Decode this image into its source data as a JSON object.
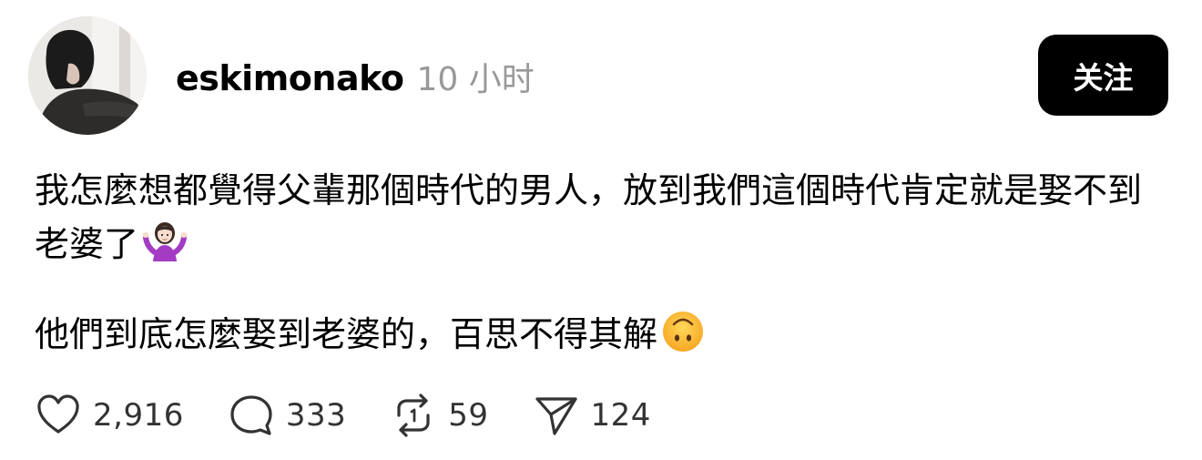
{
  "post": {
    "author": {
      "username": "eskimonako",
      "timestamp": "10 小时"
    },
    "follow_label": "关注",
    "paragraphs": [
      "我怎麼想都覺得父輩那個時代的男人，放到我們這個時代肯定就是娶不到老婆了",
      "他們到底怎麼娶到老婆的，百思不得其解"
    ],
    "emojis": [
      "person-shrugging-emoji",
      "upside-down-face-emoji"
    ],
    "stats": {
      "likes": "2,916",
      "replies": "333",
      "reposts": "59",
      "shares": "124"
    }
  }
}
